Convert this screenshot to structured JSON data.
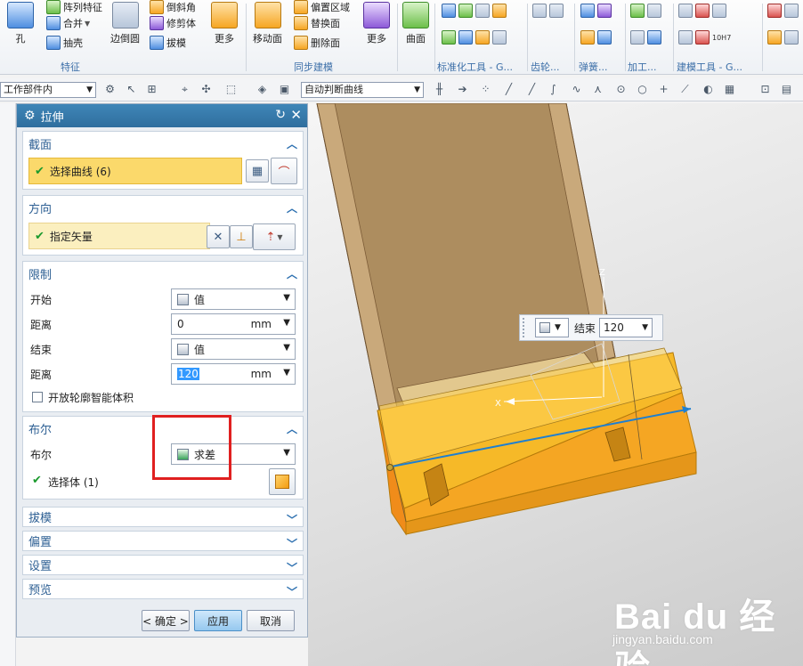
{
  "ribbon": {
    "feature": {
      "hole": "孔",
      "pattern": "阵列特征",
      "unite": "合并",
      "shell": "抽壳",
      "edge_blend": "边倒圆",
      "chamfer": "倒斜角",
      "trim_body": "修剪体",
      "draft": "拔模",
      "more": "更多",
      "group": "特征"
    },
    "sync": {
      "move_face": "移动面",
      "offset_region": "偏置区域",
      "replace_face": "替换面",
      "delete_face": "删除面",
      "more": "更多",
      "group": "同步建模"
    },
    "surface": {
      "label": "曲面"
    },
    "groups": {
      "std_tools": "标准化工具 - G...",
      "gear": "齿轮...",
      "spring": "弹簧...",
      "machining": "加工...",
      "modeling_tools": "建模工具 - G..."
    },
    "icon_sample": "10H7"
  },
  "toolbar": {
    "filter_value": "工作部件内",
    "curve_rule": "自动判断曲线"
  },
  "dialog": {
    "title": "拉伸",
    "section": {
      "title": "截面",
      "select_curve": "选择曲线 (6)"
    },
    "direction": {
      "title": "方向",
      "specify_vector": "指定矢量"
    },
    "limits": {
      "title": "限制",
      "start_label": "开始",
      "start_value": "值",
      "start_dist_label": "距离",
      "start_dist": "0",
      "end_label": "结束",
      "end_value": "值",
      "end_dist_label": "距离",
      "end_dist": "120",
      "unit": "mm",
      "open_profile": "开放轮廓智能体积"
    },
    "boolean": {
      "title": "布尔",
      "label": "布尔",
      "value": "求差",
      "select_body": "选择体 (1)"
    },
    "collapsed": {
      "draft": "拔模",
      "offset": "偏置",
      "settings": "设置",
      "preview": "预览"
    },
    "buttons": {
      "ok": "< 确定 >",
      "apply": "应用",
      "cancel": "取消"
    }
  },
  "viewport": {
    "float_label": "结束",
    "float_value": "120",
    "axis_x": "X",
    "axis_z": "Z"
  },
  "watermark": {
    "brand": "Bai du 经验",
    "url": "jingyan.baidu.com"
  }
}
